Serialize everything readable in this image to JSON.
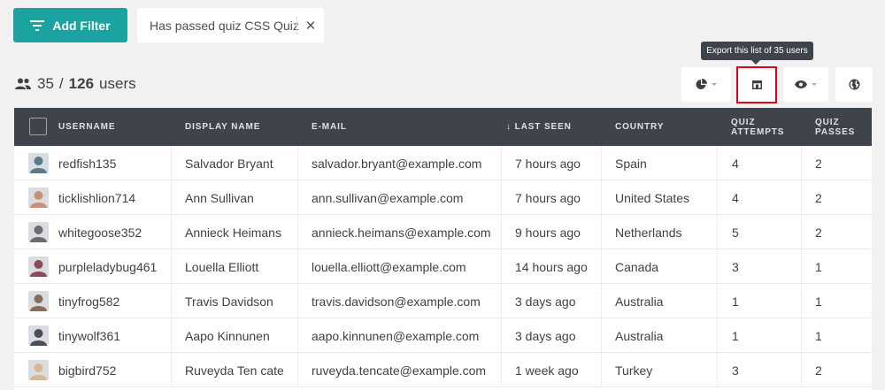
{
  "filters": {
    "add_label": "Add Filter",
    "active_chip": "Has passed quiz CSS Quiz",
    "chip_close": "✕"
  },
  "counts": {
    "filtered": "35",
    "separator": "/",
    "total": "126",
    "unit": "users"
  },
  "tooltip": "Export this list of 35 users",
  "toolbar": {
    "icons": [
      "pie-chart-icon",
      "export-icon",
      "eye-icon",
      "globe-icon"
    ]
  },
  "table": {
    "headers": {
      "username": "USERNAME",
      "display_name": "DISPLAY NAME",
      "email": "E-MAIL",
      "last_seen": "↓ LAST SEEN",
      "country": "COUNTRY",
      "quiz_attempts": "QUIZ ATTEMPTS",
      "quiz_passes": "QUIZ PASSES"
    },
    "rows": [
      {
        "username": "redfish135",
        "display_name": "Salvador Bryant",
        "email": "salvador.bryant@example.com",
        "last_seen": "7 hours ago",
        "country": "Spain",
        "quiz_attempts": "4",
        "quiz_passes": "2",
        "avatar_color": "#5b7a8c"
      },
      {
        "username": "ticklishlion714",
        "display_name": "Ann Sullivan",
        "email": "ann.sullivan@example.com",
        "last_seen": "7 hours ago",
        "country": "United States",
        "quiz_attempts": "4",
        "quiz_passes": "2",
        "avatar_color": "#c98f7a"
      },
      {
        "username": "whitegoose352",
        "display_name": "Annieck Heimans",
        "email": "annieck.heimans@example.com",
        "last_seen": "9 hours ago",
        "country": "Netherlands",
        "quiz_attempts": "5",
        "quiz_passes": "2",
        "avatar_color": "#6e6a6d"
      },
      {
        "username": "purpleladybug461",
        "display_name": "Louella Elliott",
        "email": "louella.elliott@example.com",
        "last_seen": "14 hours ago",
        "country": "Canada",
        "quiz_attempts": "3",
        "quiz_passes": "1",
        "avatar_color": "#8a4a5a"
      },
      {
        "username": "tinyfrog582",
        "display_name": "Travis Davidson",
        "email": "travis.davidson@example.com",
        "last_seen": "3 days ago",
        "country": "Australia",
        "quiz_attempts": "1",
        "quiz_passes": "1",
        "avatar_color": "#8a6b55"
      },
      {
        "username": "tinywolf361",
        "display_name": "Aapo Kinnunen",
        "email": "aapo.kinnunen@example.com",
        "last_seen": "3 days ago",
        "country": "Australia",
        "quiz_attempts": "1",
        "quiz_passes": "1",
        "avatar_color": "#4a4e57"
      },
      {
        "username": "bigbird752",
        "display_name": "Ruveyda Ten cate",
        "email": "ruveyda.tencate@example.com",
        "last_seen": "1 week ago",
        "country": "Turkey",
        "quiz_attempts": "3",
        "quiz_passes": "2",
        "avatar_color": "#d8b98f"
      }
    ]
  },
  "colors": {
    "accent": "#1aa3a0",
    "header_bg": "#3e434c",
    "highlight": "#e3001b"
  }
}
